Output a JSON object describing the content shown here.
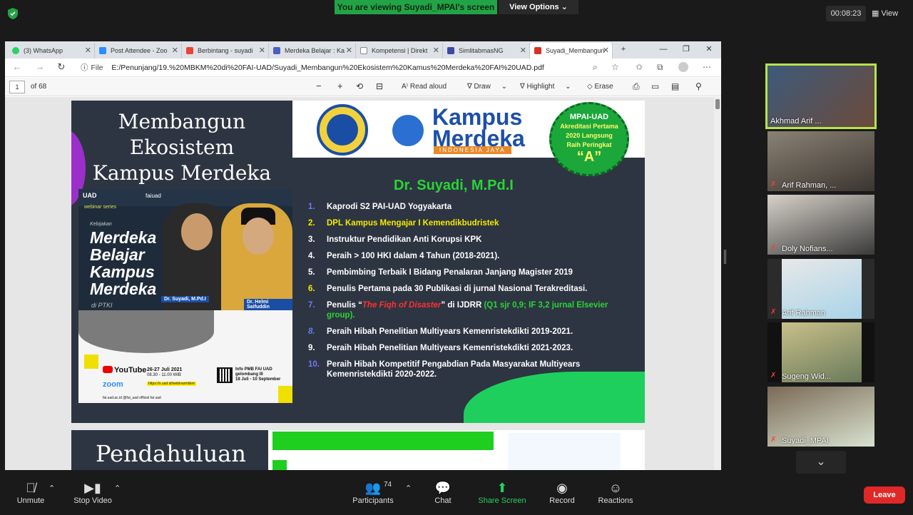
{
  "zoom": {
    "banner": "You are viewing Suyadi_MPAI's screen",
    "view_options": "View Options",
    "timer": "00:08:23",
    "view_label": "View",
    "leave": "Leave",
    "toolbar": [
      {
        "label": "Unmute",
        "icon": "mic-muted-icon"
      },
      {
        "label": "Stop Video",
        "icon": "video-icon"
      },
      {
        "label": "Participants",
        "icon": "participants-icon"
      },
      {
        "label": "Chat",
        "icon": "chat-icon"
      },
      {
        "label": "Share Screen",
        "icon": "share-screen-icon"
      },
      {
        "label": "Record",
        "icon": "record-icon"
      },
      {
        "label": "Reactions",
        "icon": "reactions-icon"
      }
    ],
    "participant_count": "74",
    "participants": [
      {
        "name": "Akhmad Arif ...",
        "muted": false
      },
      {
        "name": "Arif Rahman, ...",
        "muted": true
      },
      {
        "name": "Doly Nofians...",
        "muted": true
      },
      {
        "name": "Arif Rahman",
        "muted": true
      },
      {
        "name": "Sugeng Wid...",
        "muted": true
      },
      {
        "name": "Suyadi_MPAI",
        "muted": true
      }
    ]
  },
  "browser": {
    "tabs": [
      {
        "label": "(3) WhatsApp",
        "color": "#25d366"
      },
      {
        "label": "Post Attendee - Zoo",
        "color": "#2d8cff"
      },
      {
        "label": "Berbintang - suyadi",
        "color": "#ea4335"
      },
      {
        "label": "Merdeka Belajar : Ka",
        "color": "#4a5fc1"
      },
      {
        "label": "Kompetensi | Direkt",
        "color": "#888888"
      },
      {
        "label": "SimlitabmasNG",
        "color": "#3b4aa8"
      },
      {
        "label": "Suyadi_Membangun",
        "color": "#d93025"
      }
    ],
    "url_label": "File",
    "url": "E:/Penunjang/19.%20MBKM%20di%20FAI-UAD/Suyadi_Membangun%20Ekosistem%20Kamus%20Merdeka%20FAI%20UAD.pdf",
    "pdf": {
      "page": "1",
      "of_pages": "of 68",
      "read_aloud": "Read aloud",
      "draw": "Draw",
      "highlight": "Highlight",
      "erase": "Erase"
    }
  },
  "slide": {
    "title_lines": [
      "Membangun",
      "Ekosistem",
      "Kampus Merdeka"
    ],
    "logo_text_1": "Kampus",
    "logo_text_2": "Merdeka",
    "logo_sub": "INDONESIA JAYA",
    "badge": {
      "line1": "MPAI-UAD",
      "line2": "Akreditasi Pertama",
      "line3": "2020 Langsung",
      "line4": "Raih Peringkat",
      "grade": "“A”"
    },
    "presenter": "Dr. Suyadi, M.Pd.I",
    "poster": {
      "uad": "UAD",
      "fai": "faiuad",
      "webinar": "webinar series",
      "kebijakan": "Kebijakan",
      "big_lines": [
        "Merdeka",
        "Belajar",
        "Kampus",
        "Merdeka"
      ],
      "ptki": "di PTKI",
      "name1": "Dr. Suyadi, M.Pd.I",
      "name2": "Dr. Helmi Saifuddin",
      "youtube": "YouTube",
      "zoom": "zoom",
      "date": "26-27 Juli 2021",
      "time": "08.30 - 11.00 WIB",
      "link": "https://s.uad.id/webinarmbkm",
      "info": "Info PMB FAI UAD",
      "info2": "gelombang III",
      "info3": "18 Juli - 10 September",
      "social": "fai.uad.ac.id   @fai_uad   official fai uad"
    },
    "items": [
      {
        "num": "1.",
        "text": "Kaprodi S2 PAI-UAD Yogyakarta",
        "num_color": "blue",
        "text_color": "white"
      },
      {
        "num": "2.",
        "text": "DPL Kampus Mengajar I Kemendikbudristek",
        "num_color": "yellow",
        "text_color": "yellow"
      },
      {
        "num": "3.",
        "text": "Instruktur Pendidikan Anti Korupsi  KPK",
        "num_color": "white",
        "text_color": "white"
      },
      {
        "num": "4.",
        "text": "Peraih  > 100 HKI dalam 4 Tahun (2018-2021).",
        "num_color": "white",
        "text_color": "white"
      },
      {
        "num": "5.",
        "text": "Pembimbing Terbaik I Bidang Penalaran Janjang Magister 2019",
        "num_color": "white",
        "text_color": "white"
      },
      {
        "num": "6.",
        "text": "Penulis Pertama pada 30 Publikasi di jurnal Nasional Terakreditasi.",
        "num_color": "yellow",
        "text_color": "white"
      },
      {
        "num": "7.",
        "text_pre": "Penulis “",
        "text_red": "The Fiqh of Disaster",
        "text_mid": "” di IJDRR ",
        "text_green": "(Q1 sjr 0,9; IF 3,2 jurnal Elsevier group).",
        "num_color": "blue",
        "text_color": "white"
      },
      {
        "num": "8.",
        "text": "Peraih Hibah Penelitian Multiyears Kemenristekdikti 2019-2021.",
        "num_color": "blue",
        "text_color": "white"
      },
      {
        "num": "9.",
        "text": "Peraih Hibah Penelitian Multiyears Kemenristekdikti 2021-2023.",
        "num_color": "white",
        "text_color": "white"
      },
      {
        "num": "10.",
        "text": "Peraih Hibah Kompetitif Pengabdian Pada Masyarakat Multiyears Kemenristekdikti 2020-2022.",
        "num_color": "blue",
        "text_color": "white"
      }
    ],
    "next_title": "Pendahuluan"
  }
}
